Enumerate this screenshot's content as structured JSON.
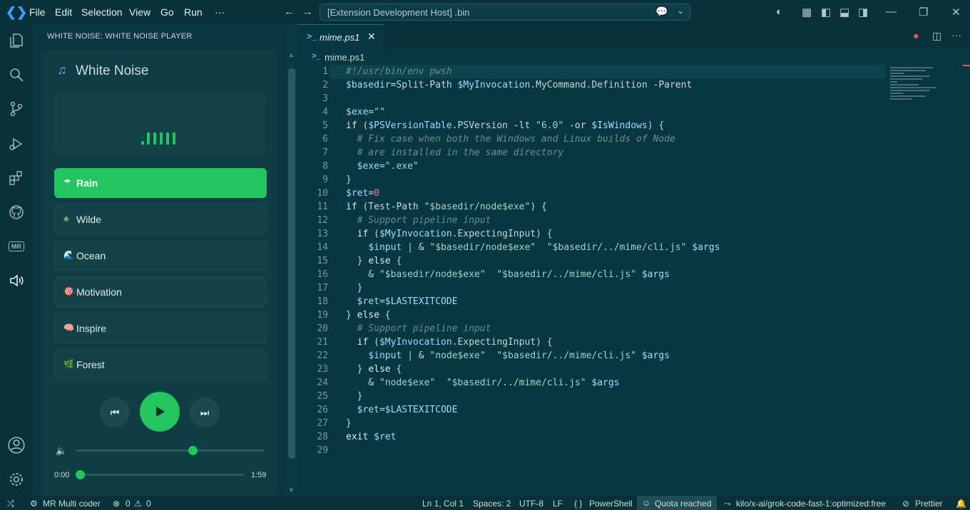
{
  "titlebar": {
    "menus": [
      "File",
      "Edit",
      "Selection",
      "View",
      "Go",
      "Run",
      "···"
    ],
    "command_center": "[Extension Development Host] .bin"
  },
  "sidebar": {
    "title": "WHITE NOISE: WHITE NOISE PLAYER",
    "app_title": "White Noise",
    "tracks": [
      {
        "label": "Rain",
        "emoji": "☂",
        "active": true
      },
      {
        "label": "Wilde",
        "emoji": "♣",
        "active": false
      },
      {
        "label": "Ocean",
        "emoji": "🌊",
        "active": false
      },
      {
        "label": "Motivation",
        "emoji": "🎯",
        "active": false
      },
      {
        "label": "Inspire",
        "emoji": "🧠",
        "active": false
      },
      {
        "label": "Forest",
        "emoji": "🌿",
        "active": false
      }
    ],
    "volume_level": 0.62,
    "progress": {
      "current": "0:00",
      "duration": "1:59",
      "fraction": 0.0
    }
  },
  "editor": {
    "tab_label": "mime.ps1",
    "breadcrumb": "mime.ps1",
    "lines": [
      "#!/usr/bin/env pwsh",
      "$basedir=Split-Path $MyInvocation.MyCommand.Definition -Parent",
      "",
      "$exe=\"\"",
      "if ($PSVersionTable.PSVersion -lt \"6.0\" -or $IsWindows) {",
      "  # Fix case when both the Windows and Linux builds of Node",
      "  # are installed in the same directory",
      "  $exe=\".exe\"",
      "}",
      "$ret=0",
      "if (Test-Path \"$basedir/node$exe\") {",
      "  # Support pipeline input",
      "  if ($MyInvocation.ExpectingInput) {",
      "    $input | & \"$basedir/node$exe\"  \"$basedir/../mime/cli.js\" $args",
      "  } else {",
      "    & \"$basedir/node$exe\"  \"$basedir/../mime/cli.js\" $args",
      "  }",
      "  $ret=$LASTEXITCODE",
      "} else {",
      "  # Support pipeline input",
      "  if ($MyInvocation.ExpectingInput) {",
      "    $input | & \"node$exe\"  \"$basedir/../mime/cli.js\" $args",
      "  } else {",
      "    & \"node$exe\"  \"$basedir/../mime/cli.js\" $args",
      "  }",
      "  $ret=$LASTEXITCODE",
      "}",
      "exit $ret",
      ""
    ]
  },
  "statusbar": {
    "remote": "MR Multi coder",
    "problems": "0",
    "warnings": "0",
    "position": "Ln 1, Col 1",
    "spaces": "Spaces: 2",
    "encoding": "UTF-8",
    "eol": "LF",
    "language": "PowerShell",
    "quota": "Quota reached",
    "model": "kilo/x-ai/grok-code-fast-1:optimized:free",
    "formatter": "Prettier"
  },
  "colors": {
    "accent_green": "#22c55e",
    "bg": "#073841"
  }
}
